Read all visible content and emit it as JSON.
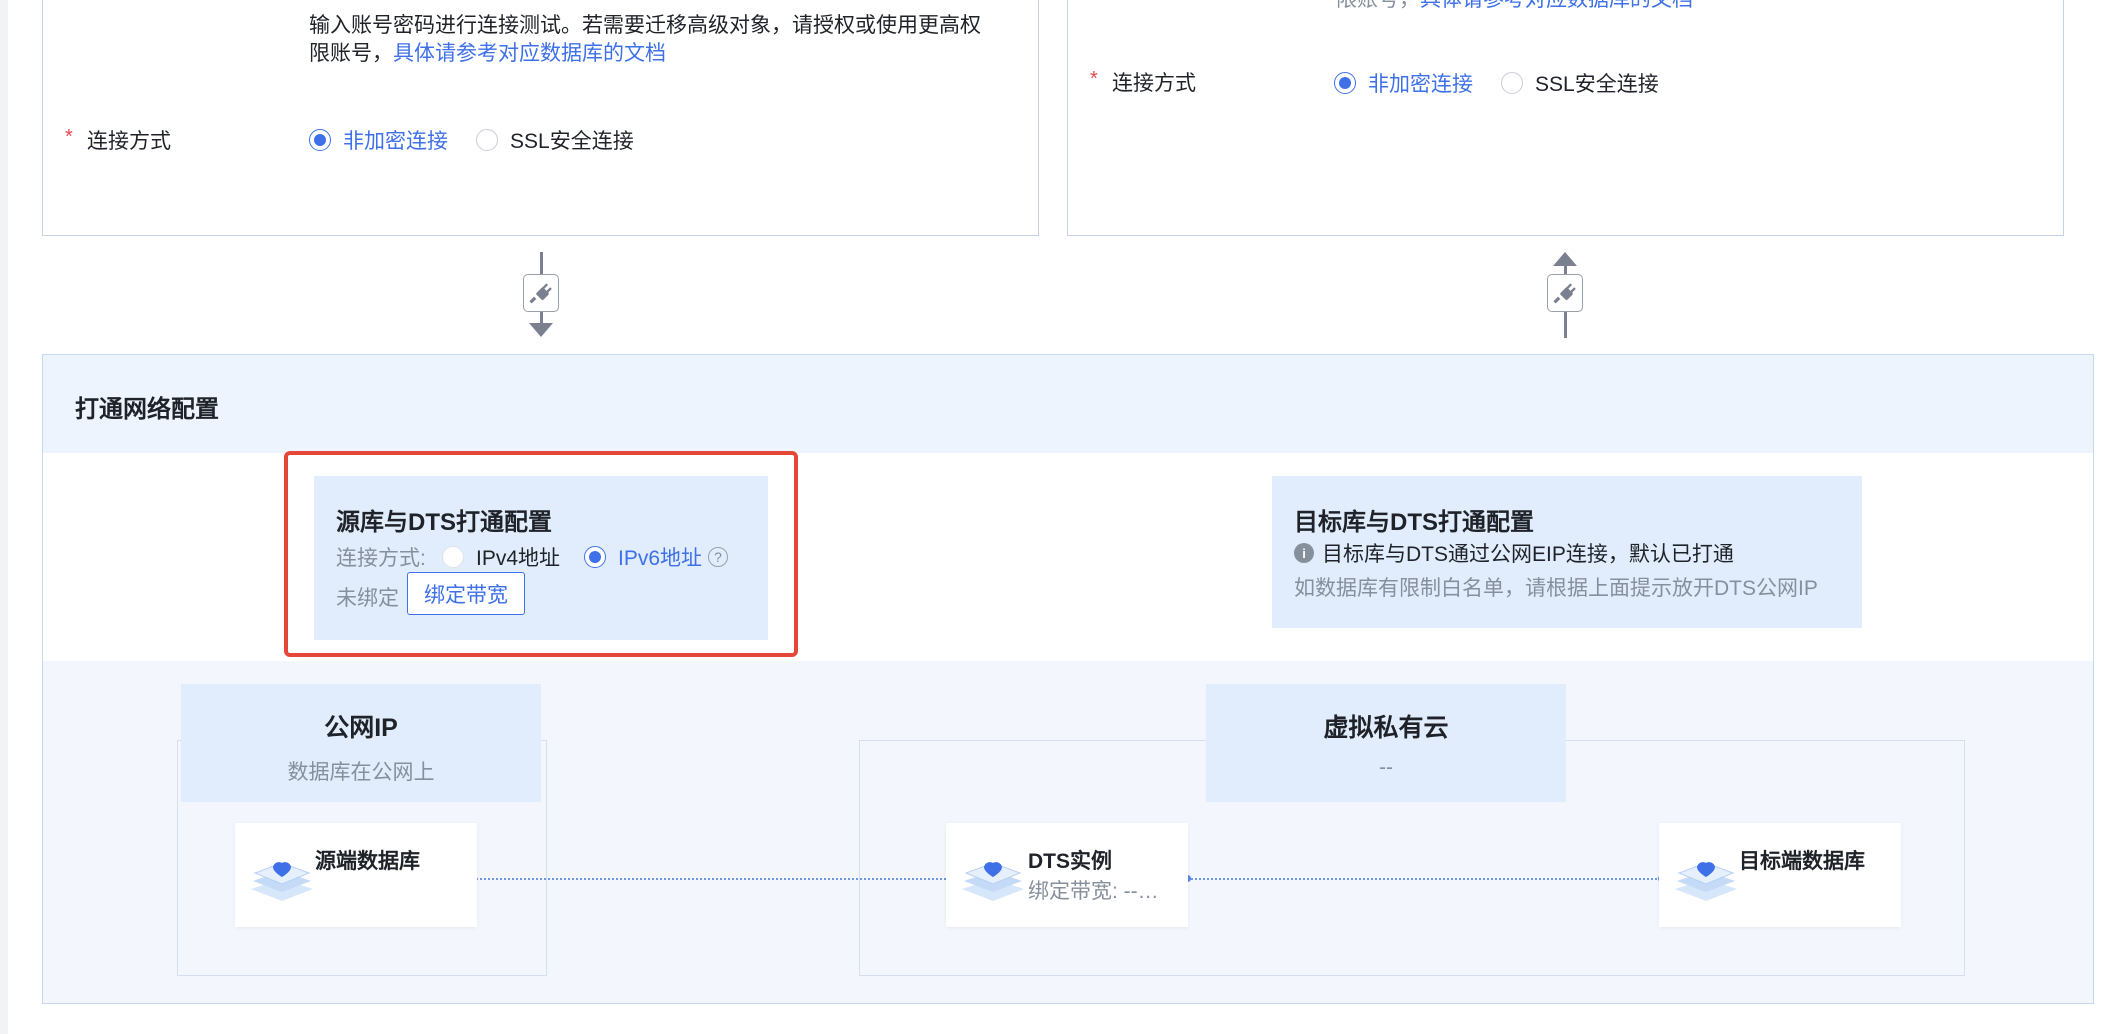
{
  "source_card": {
    "desc_line1": "输入账号密码进行连接测试。若需要迁移高级对象，请授权或使用更高权",
    "desc_line2": "限账号，",
    "desc_link": "具体请参考对应数据库的文档",
    "conn_label": "连接方式",
    "required": "*",
    "options": [
      "非加密连接",
      "SSL安全连接"
    ]
  },
  "target_card": {
    "desc_fragment": "限账号，",
    "desc_link": "具体请参考对应数据库的文档",
    "conn_label": "连接方式",
    "required": "*",
    "options": [
      "非加密连接",
      "SSL安全连接"
    ]
  },
  "network": {
    "title": "打通网络配置",
    "source_cfg": {
      "title": "源库与DTS打通配置",
      "conn_label": "连接方式:",
      "options": [
        "IPv4地址",
        "IPv6地址"
      ],
      "help": "?",
      "status": "未绑定",
      "bind_button": "绑定带宽"
    },
    "target_cfg": {
      "title": "目标库与DTS打通配置",
      "info_icon": "i",
      "info_text": "目标库与DTS通过公网EIP连接，默认已打通",
      "hint": "如数据库有限制白名单，请根据上面提示放开DTS公网IP"
    },
    "public_zone": {
      "title": "公网IP",
      "subtitle": "数据库在公网上"
    },
    "vpc_zone": {
      "title": "虚拟私有云",
      "subtitle": "--"
    },
    "nodes": {
      "source_db": "源端数据库",
      "dts_title": "DTS实例",
      "dts_sub": "绑定带宽: --…",
      "target_db": "目标端数据库"
    }
  },
  "colors": {
    "accent": "#3e70e8",
    "highlight": "#e4473a",
    "panel_bg": "#e1edfc"
  }
}
